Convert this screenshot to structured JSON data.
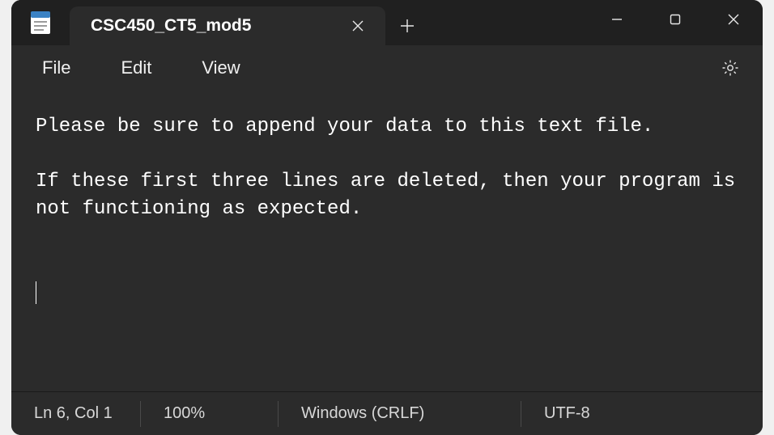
{
  "tab": {
    "title": "CSC450_CT5_mod5"
  },
  "menu": {
    "file": "File",
    "edit": "Edit",
    "view": "View"
  },
  "editor": {
    "content": "Please be sure to append your data to this text file.\n\nIf these first three lines are deleted, then your program is not functioning as expected.\n\n\n"
  },
  "status": {
    "position": "Ln 6, Col 1",
    "zoom": "100%",
    "eol": "Windows (CRLF)",
    "encoding": "UTF-8"
  }
}
